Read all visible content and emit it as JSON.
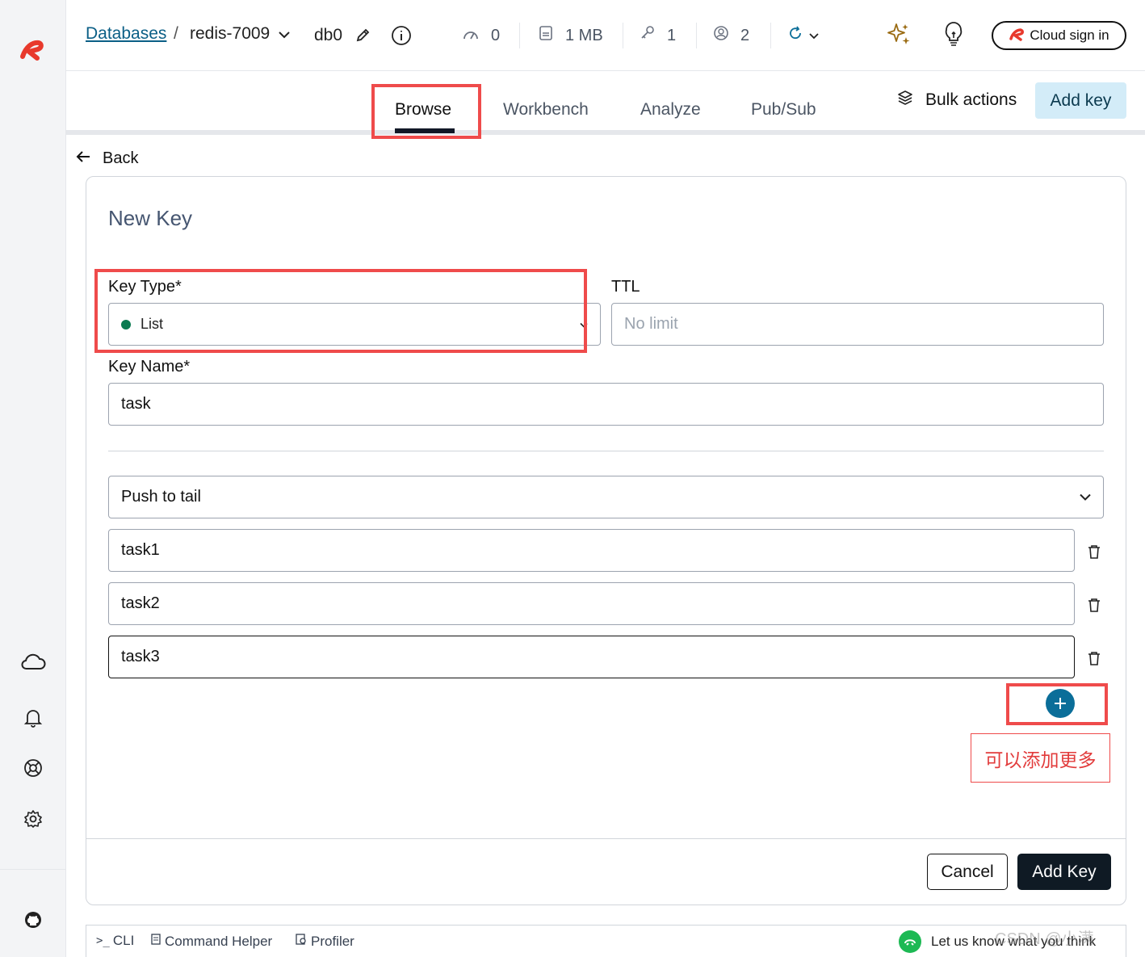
{
  "breadcrumb": {
    "databases": "Databases",
    "instance": "redis-7009",
    "db": "db0"
  },
  "stats": {
    "ops": "0",
    "memory": "1 MB",
    "keys": "1",
    "clients": "2"
  },
  "header": {
    "cloud_sign_in": "Cloud sign in"
  },
  "tabs": [
    {
      "label": "Browse",
      "active": true
    },
    {
      "label": "Workbench",
      "active": false
    },
    {
      "label": "Analyze",
      "active": false
    },
    {
      "label": "Pub/Sub",
      "active": false
    }
  ],
  "actions": {
    "bulk": "Bulk actions",
    "add_key": "Add key"
  },
  "back": "Back",
  "form": {
    "title": "New Key",
    "key_type_label": "Key Type*",
    "key_type_value": "List",
    "ttl_label": "TTL",
    "ttl_placeholder": "No limit",
    "key_name_label": "Key Name*",
    "key_name_value": "task",
    "push_mode": "Push to tail",
    "elements": [
      "task1",
      "task2",
      "task3"
    ],
    "cancel": "Cancel",
    "submit": "Add Key"
  },
  "annotation_note": "可以添加更多",
  "bottom": {
    "cli": "CLI",
    "command_helper": "Command Helper",
    "profiler": "Profiler",
    "feedback": "Let us know what you think"
  },
  "watermark": "CSDN @小满",
  "colors": {
    "accent": "#0b6e99",
    "highlight": "#ef4b4b",
    "list_dot": "#0a7a50",
    "brand": "#e8392c"
  }
}
